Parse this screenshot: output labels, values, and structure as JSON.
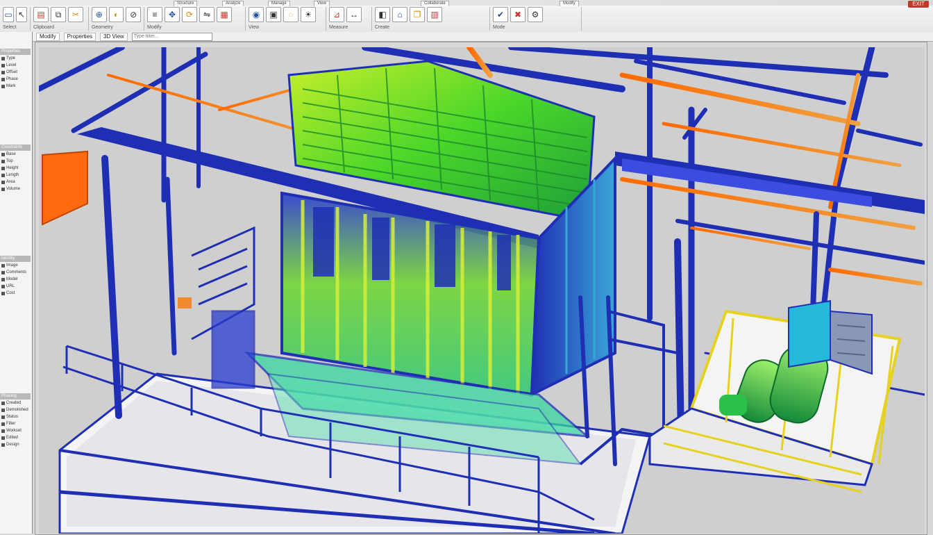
{
  "app": {
    "close_label": "EXIT"
  },
  "doc_tabs": [
    "Structure",
    "Analyze",
    "Manage",
    "View",
    "Collaborate",
    "Modify"
  ],
  "ribbon": {
    "groups": [
      {
        "label": "Select",
        "icons": [
          "select-icon",
          "modify-icon"
        ]
      },
      {
        "label": "Clipboard",
        "icons": [
          "paste-icon",
          "copy-icon",
          "cut-icon"
        ]
      },
      {
        "label": "Geometry",
        "icons": [
          "join-icon",
          "cope-icon",
          "split-icon"
        ]
      },
      {
        "label": "Modify",
        "icons": [
          "align-icon",
          "move-icon",
          "rotate-icon",
          "mirror-icon",
          "array-icon"
        ]
      },
      {
        "label": "View",
        "icons": [
          "view-icon",
          "section-icon",
          "hide-icon",
          "render-icon"
        ]
      },
      {
        "label": "Measure",
        "icons": [
          "measure-icon",
          "dimension-icon"
        ]
      },
      {
        "label": "Create",
        "icons": [
          "component-icon",
          "family-icon",
          "group-icon",
          "assembly-icon"
        ]
      },
      {
        "label": "Mode",
        "icons": [
          "finish-icon",
          "cancel-icon",
          "settings-icon"
        ]
      }
    ]
  },
  "subbar": {
    "items": [
      "Modify",
      "Properties",
      "3D View"
    ],
    "search_placeholder": "Type filter..."
  },
  "left_panel": {
    "sections": [
      {
        "title": "Properties",
        "rows": [
          "Type",
          "Level",
          "Offset",
          "Phase",
          "Mark"
        ]
      },
      {
        "title": "Constraints",
        "rows": [
          "Base",
          "Top",
          "Height",
          "Length",
          "Area",
          "Volume"
        ]
      },
      {
        "title": "Identity",
        "rows": [
          "Image",
          "Comments",
          "Model",
          "URL",
          "Cost"
        ]
      },
      {
        "title": "Phasing",
        "rows": [
          "Created",
          "Demolished",
          "Status",
          "Filter",
          "Workset",
          "Edited",
          "Design"
        ]
      }
    ]
  },
  "colors": {
    "frame_blue": "#1f2fb4",
    "pipe_orange": "#f07a1a",
    "equipment_green": "#4ad62a",
    "highlight_yellow": "#e6d21e",
    "floor_white": "#f4f4f4"
  }
}
